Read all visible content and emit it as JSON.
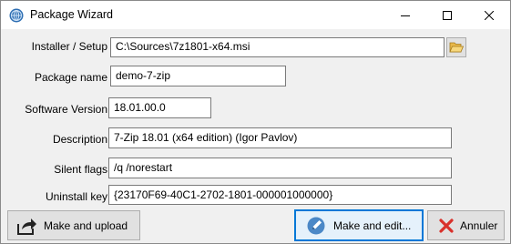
{
  "window": {
    "title": "Package Wizard",
    "icon": "globe-app-icon",
    "controls": {
      "minimize": "minimize-icon",
      "maximize": "maximize-icon",
      "close": "close-icon"
    }
  },
  "form": {
    "installer": {
      "label": "Installer / Setup",
      "value": "C:\\Sources\\7z1801-x64.msi",
      "browse_icon": "folder-open-icon"
    },
    "package_name": {
      "label": "Package name",
      "value": "demo-7-zip"
    },
    "software_version": {
      "label": "Software Version",
      "value": "18.01.00.0"
    },
    "description": {
      "label": "Description",
      "value": "7-Zip 18.01 (x64 edition) (Igor Pavlov)"
    },
    "silent_flags": {
      "label": "Silent flags",
      "value": "/q /norestart"
    },
    "uninstall_key": {
      "label": "Uninstall key",
      "value": "{23170F69-40C1-2702-1801-000001000000}"
    }
  },
  "buttons": {
    "make_upload": {
      "label": "Make and upload",
      "icon": "share-arrow-icon"
    },
    "make_edit": {
      "label": "Make and edit...",
      "icon": "pencil-icon"
    },
    "cancel": {
      "label": "Annuler",
      "icon": "red-x-icon"
    }
  },
  "colors": {
    "focus_border": "#0078d7",
    "cancel_red": "#d9312b",
    "titlebar_bg": "#ffffff",
    "body_bg": "#f0f0f0"
  }
}
